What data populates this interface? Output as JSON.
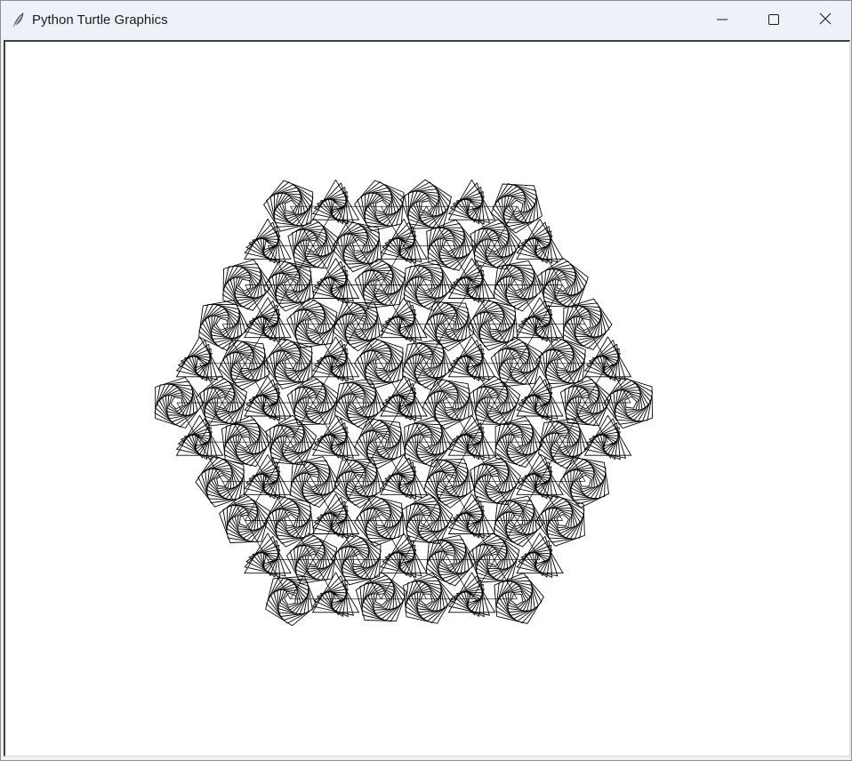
{
  "window": {
    "title": "Python Turtle Graphics"
  },
  "icons": {
    "app": "feather-icon",
    "minimize": "minimize-icon",
    "maximize": "maximize-icon",
    "close": "close-icon"
  },
  "canvas": {
    "background": "#ffffff",
    "pen_color": "#000000"
  }
}
